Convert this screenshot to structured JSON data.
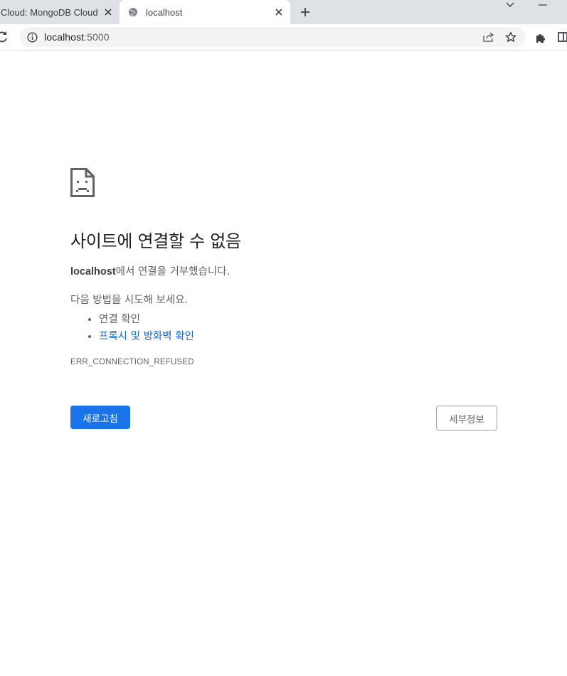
{
  "browser": {
    "tabs": [
      {
        "title": "Cloud: MongoDB Cloud",
        "active": false
      },
      {
        "title": "localhost",
        "active": true
      }
    ],
    "url_host": "localhost",
    "url_port": ":5000"
  },
  "error_page": {
    "heading": "사이트에 연결할 수 없음",
    "summary_host": "localhost",
    "summary_text": "에서 연결을 거부했습니다.",
    "suggestions_heading": "다음 방법을 시도해 보세요.",
    "suggestions": [
      {
        "text": "연결 확인",
        "link": false
      },
      {
        "text": "프록시 및 방화벽 확인",
        "link": true
      }
    ],
    "error_code": "ERR_CONNECTION_REFUSED",
    "reload_button": "새로고침",
    "details_button": "세부정보"
  },
  "colors": {
    "primary_button": "#1a73e8",
    "link": "#1967d2",
    "tabstrip": "#dee1e6"
  }
}
